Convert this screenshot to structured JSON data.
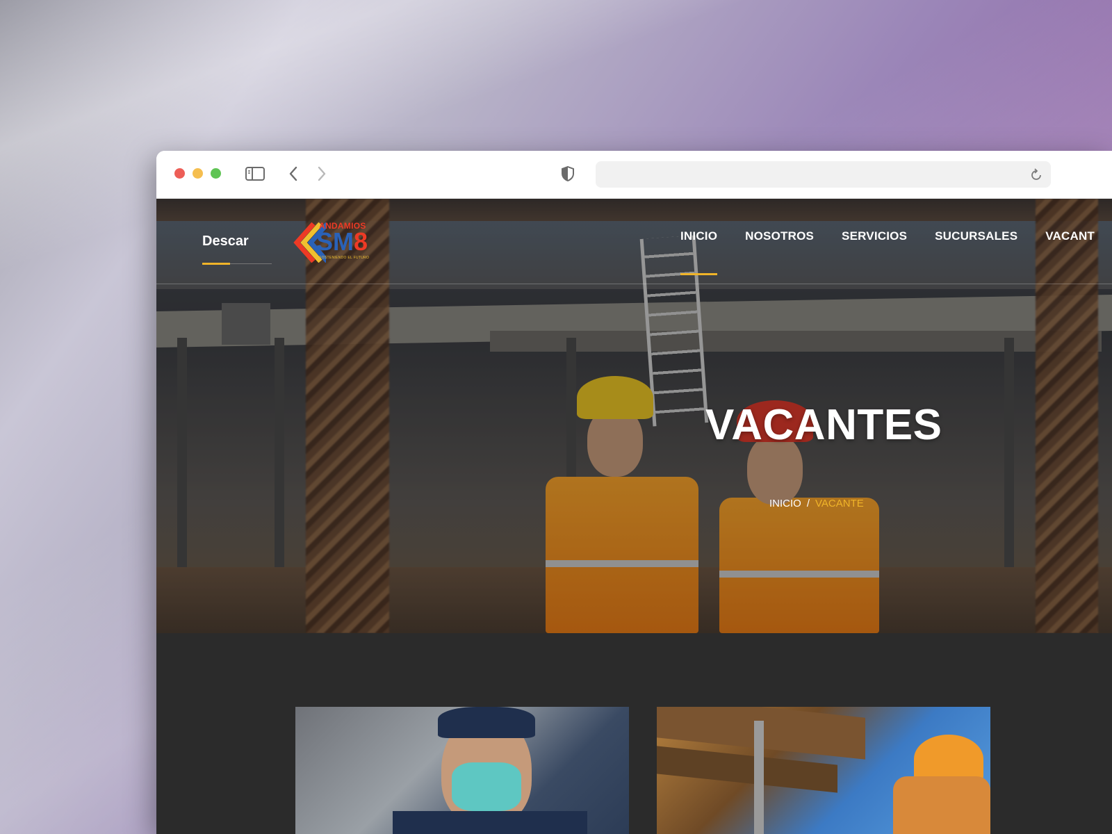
{
  "browser": {
    "url": ""
  },
  "logo": {
    "top_text": "ANDAMIOS",
    "main_text": "SM",
    "main_digit": "8",
    "tagline": "SOSTENIENDO EL FUTURO"
  },
  "nav": {
    "items": [
      {
        "label": "INICIO",
        "active": true
      },
      {
        "label": "NOSOTROS",
        "active": false
      },
      {
        "label": "SERVICIOS",
        "active": false
      },
      {
        "label": "SUCURSALES",
        "active": false
      },
      {
        "label": "VACANT",
        "active": false
      }
    ]
  },
  "hero": {
    "title": "VACANTES",
    "breadcrumb": {
      "home": "INICIO",
      "separator": "/",
      "current": "VACANTE"
    }
  },
  "sidebar_card": {
    "title": "Descar"
  },
  "colors": {
    "accent": "#f0b429",
    "logo_blue": "#2a62b8",
    "logo_red": "#ee3a25",
    "page_background": "#2b2b2b"
  }
}
